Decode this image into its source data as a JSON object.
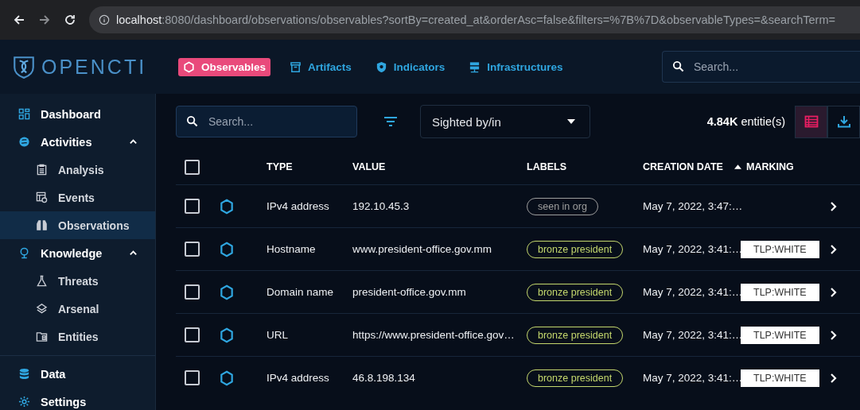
{
  "browser": {
    "host": "localhost",
    "path": ":8080/dashboard/observations/observables?sortBy=created_at&orderAsc=false&filters=%7B%7D&observableTypes=&searchTerm="
  },
  "header": {
    "logo": "OPENCTI",
    "tabs": [
      {
        "label": "Observables",
        "selected": true
      },
      {
        "label": "Artifacts",
        "selected": false
      },
      {
        "label": "Indicators",
        "selected": false
      },
      {
        "label": "Infrastructures",
        "selected": false
      }
    ],
    "search": {
      "placeholder": "Search..."
    }
  },
  "sidebar": {
    "items": [
      {
        "label": "Dashboard",
        "selected": false
      },
      {
        "label": "Activities",
        "selected": false,
        "expanded": true,
        "children": [
          {
            "label": "Analysis",
            "selected": false
          },
          {
            "label": "Events",
            "selected": false
          },
          {
            "label": "Observations",
            "selected": true
          }
        ]
      },
      {
        "label": "Knowledge",
        "selected": false,
        "expanded": true,
        "children": [
          {
            "label": "Threats",
            "selected": false
          },
          {
            "label": "Arsenal",
            "selected": false
          },
          {
            "label": "Entities",
            "selected": false
          }
        ]
      },
      {
        "label": "Data",
        "selected": false
      },
      {
        "label": "Settings",
        "selected": false
      }
    ]
  },
  "toolbar": {
    "search": {
      "placeholder": "Search..."
    },
    "filter": {
      "value": "Sighted by/in"
    },
    "count": "4.84K",
    "count_unit": "entitie(s)"
  },
  "table": {
    "all_checked": false,
    "columns": [
      "TYPE",
      "VALUE",
      "LABELS",
      "CREATION DATE",
      "MARKING"
    ],
    "rows": [
      {
        "checked": false,
        "type": "IPv4 address",
        "value": "192.10.45.3",
        "label": {
          "text": "seen in org",
          "color": "#9e9e9e"
        },
        "date": "May 7, 2022, 3:47:…"
      },
      {
        "checked": false,
        "type": "Hostname",
        "value": "www.president-office.gov.mm",
        "label": {
          "text": "bronze president",
          "color": "#c5d86d"
        },
        "date": "May 7, 2022, 3:41:…",
        "marking": "TLP:WHITE"
      },
      {
        "checked": false,
        "type": "Domain name",
        "value": "president-office.gov.mm",
        "label": {
          "text": "bronze president",
          "color": "#c5d86d"
        },
        "date": "May 7, 2022, 3:41:…",
        "marking": "TLP:WHITE"
      },
      {
        "checked": false,
        "type": "URL",
        "value": "https://www.president-office.gov…",
        "label": {
          "text": "bronze president",
          "color": "#c5d86d"
        },
        "date": "May 7, 2022, 3:41:…",
        "marking": "TLP:WHITE"
      },
      {
        "checked": false,
        "type": "IPv4 address",
        "value": "46.8.198.134",
        "label": {
          "text": "bronze president",
          "color": "#c5d86d"
        },
        "date": "May 7, 2022, 3:41:…",
        "marking": "TLP:WHITE"
      }
    ]
  }
}
